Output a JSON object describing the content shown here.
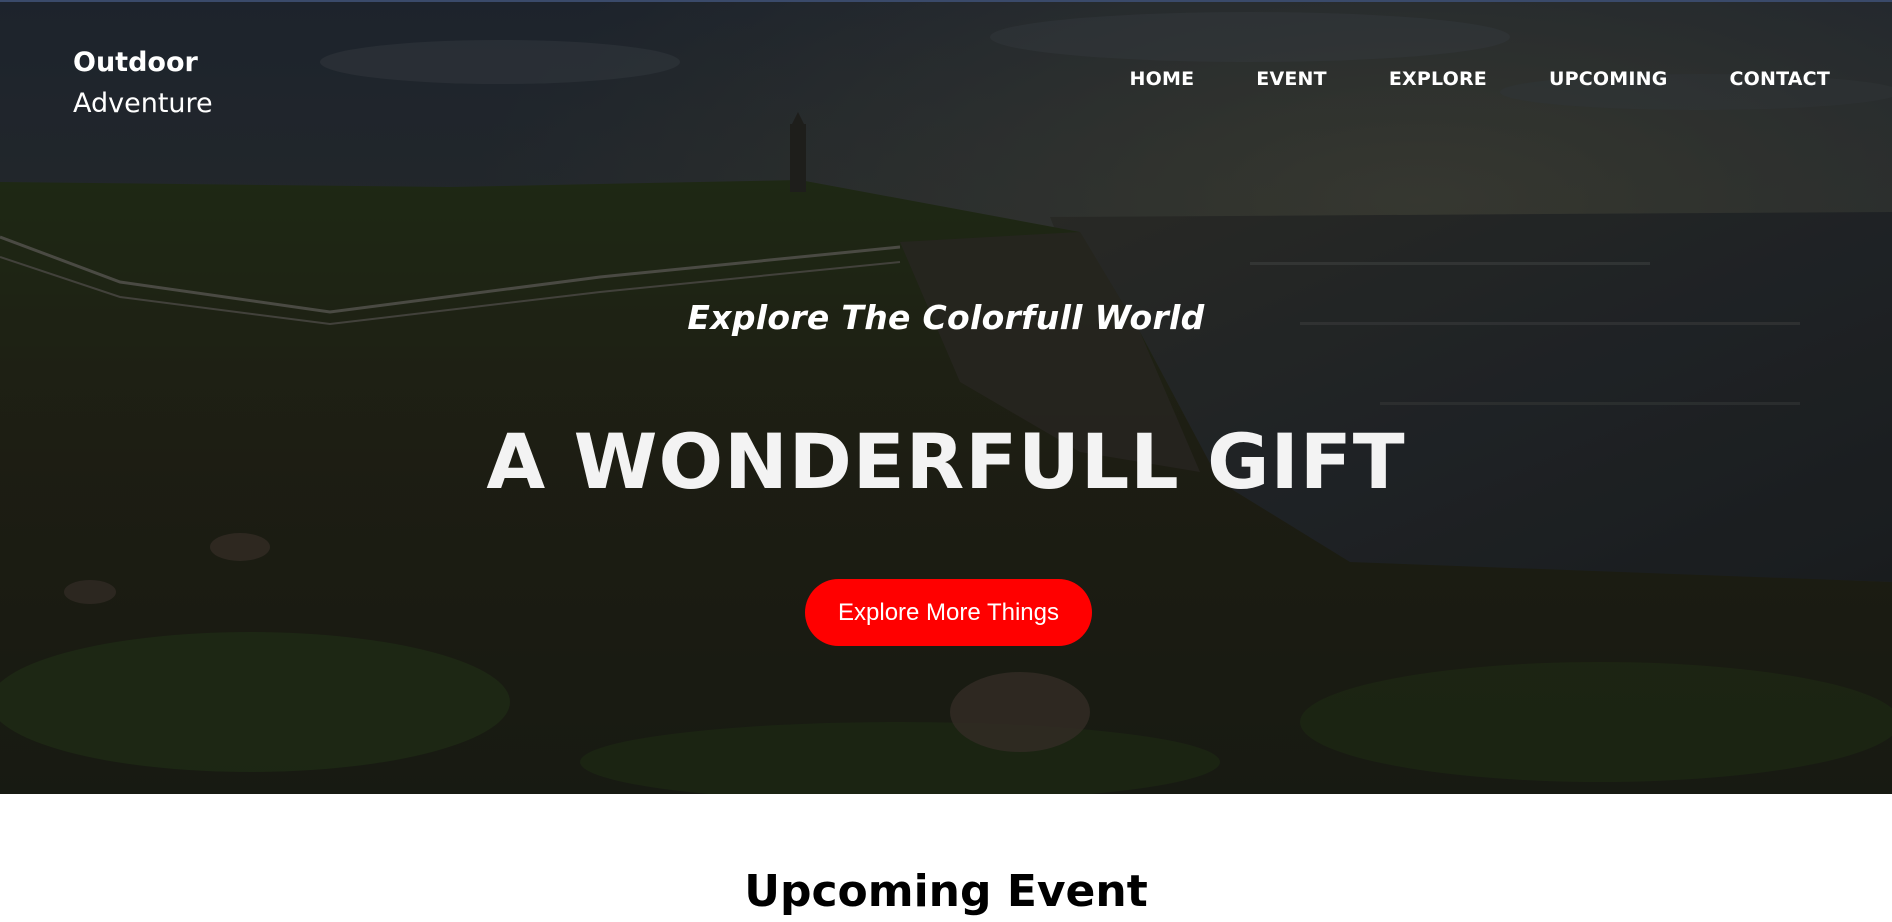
{
  "brand": {
    "line1": "Outdoor",
    "line2": "Adventure"
  },
  "nav": {
    "items": [
      {
        "label": "HOME"
      },
      {
        "label": "EVENT"
      },
      {
        "label": "EXPLORE"
      },
      {
        "label": "UPCOMING"
      },
      {
        "label": "CONTACT"
      }
    ]
  },
  "hero": {
    "tagline": "Explore The Colorfull World",
    "headline": "A WONDERFULL GIFT",
    "cta_label": "Explore More Things",
    "background_image": "coastal-cliff-lighthouse"
  },
  "upcoming": {
    "title": "Upcoming Event"
  },
  "colors": {
    "cta": "#ff0000",
    "text_light": "#ffffff",
    "section_title": "#000000"
  }
}
